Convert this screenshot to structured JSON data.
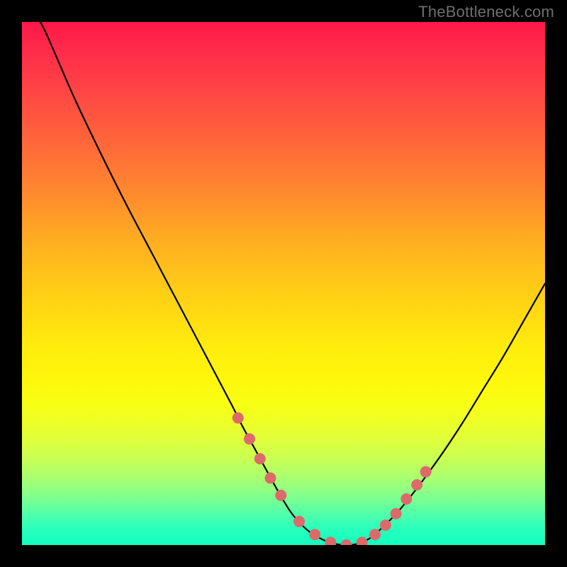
{
  "watermark": "TheBottleneck.com",
  "chart_data": {
    "type": "line",
    "title": "",
    "xlabel": "",
    "ylabel": "",
    "xlim": [
      0,
      100
    ],
    "ylim": [
      0,
      100
    ],
    "grid": false,
    "legend": false,
    "series": [
      {
        "name": "curve",
        "color": "#000000",
        "x": [
          3.5,
          5,
          10,
          15,
          20,
          25,
          30,
          35,
          40,
          42,
          45,
          48,
          50,
          52,
          55,
          58,
          60,
          62,
          64,
          66,
          68,
          72,
          76,
          80,
          84,
          88,
          92,
          96,
          100
        ],
        "values": [
          100,
          97,
          85.5,
          75,
          65,
          55.5,
          46,
          36.5,
          27,
          23,
          17.5,
          12,
          8.5,
          5.5,
          2.5,
          0.8,
          0.2,
          0,
          0.2,
          1,
          2.5,
          6.5,
          11.5,
          17,
          23,
          29.5,
          36,
          43,
          50
        ]
      }
    ],
    "markers": {
      "name": "dots",
      "color": "#dd6a6a",
      "radius_px": 8,
      "x": [
        41.3,
        43.5,
        45.5,
        47.5,
        49.5,
        53.0,
        56.0,
        59.0,
        62.0,
        65.0,
        67.5,
        69.5,
        71.5,
        73.5,
        75.5,
        77.2
      ],
      "values": [
        24.3,
        20.3,
        16.5,
        12.8,
        9.5,
        4.5,
        2.0,
        0.5,
        0.0,
        0.5,
        2.0,
        3.8,
        6.0,
        8.8,
        11.5,
        14.0
      ]
    },
    "background_gradient": {
      "type": "vertical",
      "stops": [
        {
          "pos": 0.0,
          "color": "#ff1849"
        },
        {
          "pos": 0.5,
          "color": "#ffd014"
        },
        {
          "pos": 0.8,
          "color": "#d8ff44"
        },
        {
          "pos": 1.0,
          "color": "#14ffbf"
        }
      ]
    }
  }
}
